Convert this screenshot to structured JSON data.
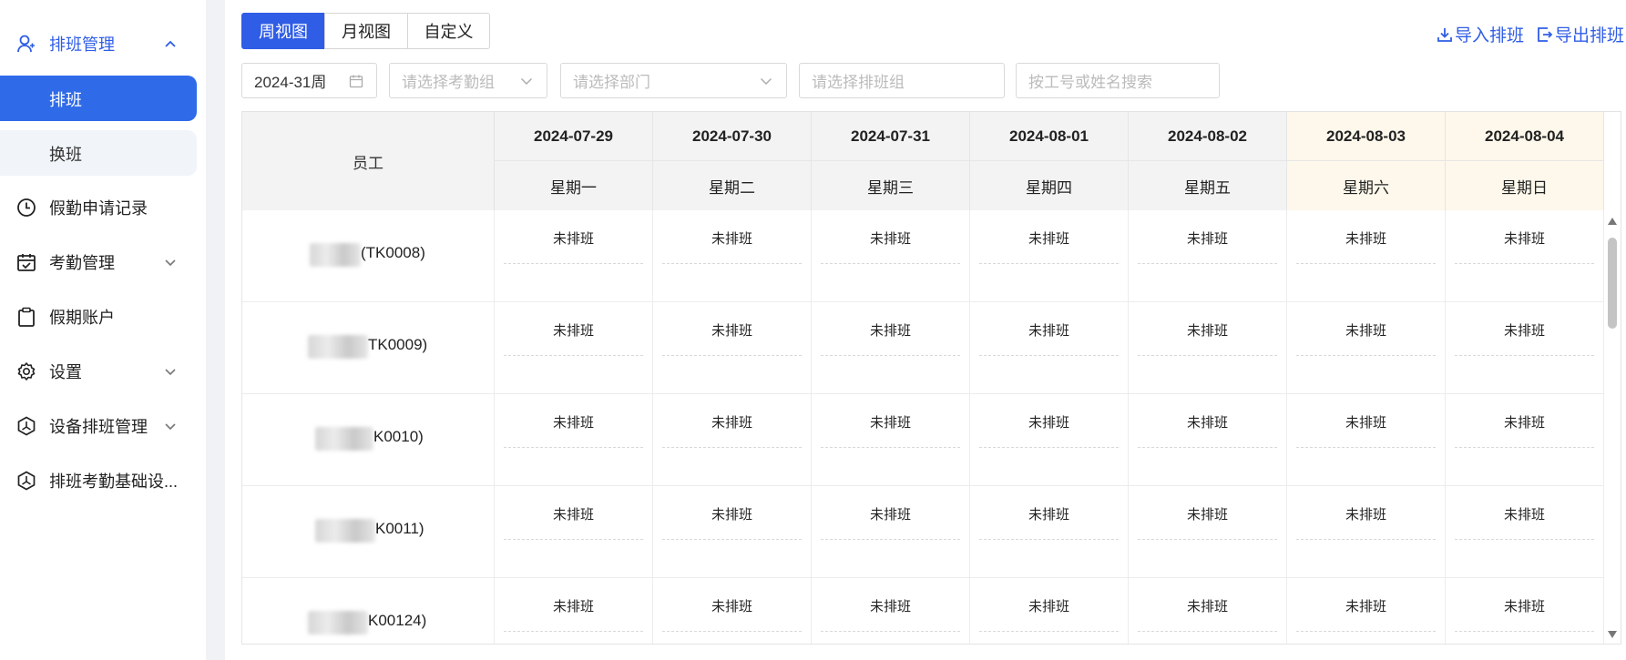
{
  "sidebar": {
    "menu_schedule": "排班管理",
    "sub_schedule": "排班",
    "sub_swap": "换班",
    "menu_leave_records": "假勤申请记录",
    "menu_attendance": "考勤管理",
    "menu_leave_account": "假期账户",
    "menu_settings": "设置",
    "menu_device_schedule": "设备排班管理",
    "menu_basic_settings": "排班考勤基础设..."
  },
  "toolbar": {
    "tab_week": "周视图",
    "tab_month": "月视图",
    "tab_custom": "自定义",
    "import_label": "导入排班",
    "export_label": "导出排班"
  },
  "filters": {
    "week_value": "2024-31周",
    "attendance_group_placeholder": "请选择考勤组",
    "department_placeholder": "请选择部门",
    "schedule_group_placeholder": "请选择排班组",
    "search_placeholder": "按工号或姓名搜索"
  },
  "table": {
    "employee_header": "员工",
    "days": [
      {
        "date": "2024-07-29",
        "weekday": "星期一"
      },
      {
        "date": "2024-07-30",
        "weekday": "星期二"
      },
      {
        "date": "2024-07-31",
        "weekday": "星期三"
      },
      {
        "date": "2024-08-01",
        "weekday": "星期四"
      },
      {
        "date": "2024-08-02",
        "weekday": "星期五"
      },
      {
        "date": "2024-08-03",
        "weekday": "星期六"
      },
      {
        "date": "2024-08-04",
        "weekday": "星期日"
      }
    ],
    "rows": [
      {
        "code": "(TK0008)",
        "cells": [
          "未排班",
          "未排班",
          "未排班",
          "未排班",
          "未排班",
          "未排班",
          "未排班"
        ]
      },
      {
        "code": "TK0009)",
        "cells": [
          "未排班",
          "未排班",
          "未排班",
          "未排班",
          "未排班",
          "未排班",
          "未排班"
        ]
      },
      {
        "code": "K0010)",
        "cells": [
          "未排班",
          "未排班",
          "未排班",
          "未排班",
          "未排班",
          "未排班",
          "未排班"
        ]
      },
      {
        "code": "K0011)",
        "cells": [
          "未排班",
          "未排班",
          "未排班",
          "未排班",
          "未排班",
          "未排班",
          "未排班"
        ]
      },
      {
        "code": "K00124)",
        "cells": [
          "未排班",
          "未排班",
          "未排班",
          "未排班",
          "未排班",
          "未排班",
          "未排班"
        ]
      }
    ]
  },
  "colors": {
    "accent": "#2f5de6",
    "selected_item": "#2f6be9",
    "weekend_header": "#fdf8eb"
  }
}
